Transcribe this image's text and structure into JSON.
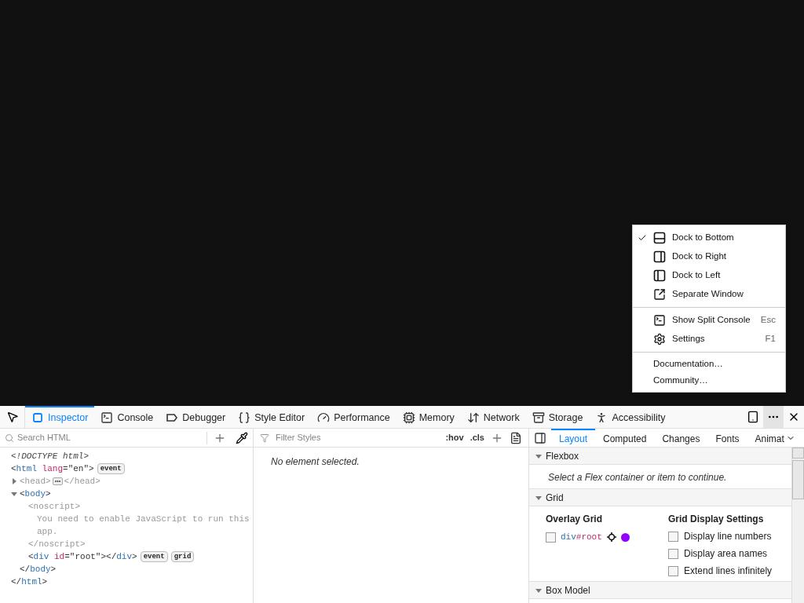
{
  "toolbar": {
    "tabs": [
      {
        "label": "Inspector",
        "selected": true
      },
      {
        "label": "Console",
        "selected": false
      },
      {
        "label": "Debugger",
        "selected": false
      },
      {
        "label": "Style Editor",
        "selected": false
      },
      {
        "label": "Performance",
        "selected": false
      },
      {
        "label": "Memory",
        "selected": false
      },
      {
        "label": "Network",
        "selected": false
      },
      {
        "label": "Storage",
        "selected": false
      },
      {
        "label": "Accessibility",
        "selected": false
      }
    ]
  },
  "menu": {
    "sections": [
      [
        {
          "kind": "item",
          "label": "Dock to Bottom",
          "checked": true
        },
        {
          "kind": "item",
          "label": "Dock to Right",
          "checked": false
        },
        {
          "kind": "item",
          "label": "Dock to Left",
          "checked": false
        },
        {
          "kind": "item",
          "label": "Separate Window",
          "checked": false
        }
      ],
      [
        {
          "kind": "item",
          "label": "Show Split Console",
          "shortcut": "Esc"
        },
        {
          "kind": "item",
          "label": "Settings",
          "shortcut": "F1"
        }
      ],
      [
        {
          "kind": "link",
          "label": "Documentation…"
        },
        {
          "kind": "link",
          "label": "Community…"
        }
      ]
    ]
  },
  "markup": {
    "search": {
      "placeholder": "Search HTML"
    },
    "tree": [
      {
        "line": [
          {
            "kind": "doctype",
            "s": "<!DOCTYPE html>"
          }
        ]
      },
      {
        "line": [
          {
            "kind": "punct",
            "s": "<"
          },
          {
            "kind": "tag",
            "s": "html"
          },
          {
            "kind": "attr",
            "s": " lang"
          },
          {
            "kind": "punct",
            "s": "=\"en\">"
          }
        ],
        "badges": [
          "event"
        ],
        "close": [
          {
            "kind": "punct",
            "s": "</"
          },
          {
            "kind": "tag",
            "s": "html"
          },
          {
            "kind": "punct",
            "s": ">"
          }
        ],
        "children": [
          {
            "expanded": false,
            "line": [
              {
                "kind": "dim",
                "s": "<head>"
              }
            ],
            "close": [
              {
                "kind": "dim",
                "s": "</head>"
              }
            ]
          },
          {
            "expanded": true,
            "line": [
              {
                "kind": "punct",
                "s": "<"
              },
              {
                "kind": "tag",
                "s": "body"
              },
              {
                "kind": "punct",
                "s": ">"
              }
            ],
            "close": [
              {
                "kind": "punct",
                "s": "</"
              },
              {
                "kind": "tag",
                "s": "body"
              },
              {
                "kind": "punct",
                "s": ">"
              }
            ],
            "children": [
              {
                "line": [
                  {
                    "kind": "dim",
                    "s": "<noscript>"
                  }
                ],
                "children": [
                  {
                    "line": [
                      {
                        "kind": "dim",
                        "s": "You need to enable JavaScript to run this app."
                      }
                    ]
                  }
                ],
                "close": [
                  {
                    "kind": "dim",
                    "s": "</noscript>"
                  }
                ]
              },
              {
                "line": [
                  {
                    "kind": "punct",
                    "s": "<"
                  },
                  {
                    "kind": "tag",
                    "s": "div"
                  },
                  {
                    "kind": "attr",
                    "s": " id"
                  },
                  {
                    "kind": "punct",
                    "s": "=\"root\"></"
                  },
                  {
                    "kind": "tag",
                    "s": "div"
                  },
                  {
                    "kind": "punct",
                    "s": ">"
                  }
                ],
                "badges": [
                  "event",
                  "grid"
                ]
              }
            ]
          }
        ]
      }
    ]
  },
  "rules": {
    "filter": {
      "placeholder": "Filter Styles"
    },
    "buttons": [
      ":hov",
      ".cls"
    ],
    "empty": "No element selected."
  },
  "sidebar": {
    "tabs": [
      {
        "label": "Layout",
        "selected": true
      },
      {
        "label": "Computed",
        "selected": false
      },
      {
        "label": "Changes",
        "selected": false
      },
      {
        "label": "Fonts",
        "selected": false
      },
      {
        "label": "Animat",
        "selected": false
      }
    ],
    "sections": [
      {
        "kind": "flexbox",
        "title": "Flexbox",
        "expanded": true,
        "message": "Select a Flex container or item to continue."
      },
      {
        "kind": "grid",
        "title": "Grid",
        "expanded": true,
        "overlay_title": "Overlay Grid",
        "overlay": {
          "selector_tag": "div",
          "selector_id": "#root",
          "checked": false,
          "color": "#9400ff"
        },
        "settings_title": "Grid Display Settings",
        "settings": [
          {
            "label": "Display line numbers",
            "checked": false
          },
          {
            "label": "Display area names",
            "checked": false
          },
          {
            "label": "Extend lines infinitely",
            "checked": false
          }
        ]
      },
      {
        "kind": "boxmodel",
        "title": "Box Model",
        "expanded": true
      }
    ]
  }
}
